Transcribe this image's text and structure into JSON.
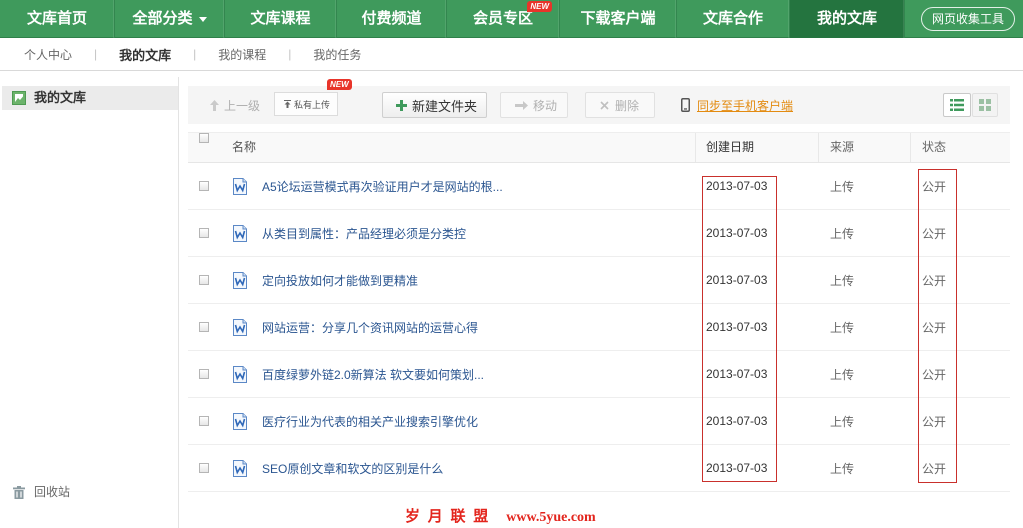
{
  "colors": {
    "nav_green": "#3f9a5c",
    "nav_active": "#24743f",
    "badge_red": "#e8342a",
    "link_orange": "#e38b11",
    "title_blue": "#2a5590",
    "annotation_red": "#c9302c",
    "watermark_red": "#e3251d"
  },
  "nav": {
    "items": [
      {
        "label": "文库首页"
      },
      {
        "label": "全部分类",
        "icon": "caret-down-icon"
      },
      {
        "label": "文库课程"
      },
      {
        "label": "付费频道"
      },
      {
        "label": "会员专区",
        "badge": "NEW"
      },
      {
        "label": "下载客户端"
      },
      {
        "label": "文库合作"
      },
      {
        "label": "我的文库",
        "active": true
      }
    ],
    "tool_button": "网页收集工具"
  },
  "subnav": {
    "separator": "|",
    "items": [
      {
        "label": "个人中心"
      },
      {
        "label": "我的文库",
        "active": true
      },
      {
        "label": "我的课程"
      },
      {
        "label": "我的任务"
      }
    ]
  },
  "sidebar": {
    "library": {
      "label": "我的文库",
      "icon": "library-icon",
      "selected": true
    },
    "recycle_bin": {
      "label": "回收站",
      "icon": "trash-icon"
    }
  },
  "toolbar": {
    "up_level": {
      "label": "上一级",
      "icon": "arrow-up-icon",
      "disabled": true
    },
    "private_upload": {
      "label": "私有上传",
      "icon": "upload-icon",
      "badge": "NEW"
    },
    "new_folder": {
      "label": "新建文件夹",
      "icon": "plus-icon"
    },
    "move": {
      "label": "移动",
      "icon": "arrow-right-icon",
      "disabled": true
    },
    "delete": {
      "label": "删除",
      "icon": "close-icon",
      "disabled": true
    },
    "sync_mobile": {
      "label": "同步至手机客户端",
      "icon": "phone-icon"
    },
    "view_modes": [
      {
        "icon": "list-view-icon",
        "active": true
      },
      {
        "icon": "grid-view-icon",
        "active": false
      }
    ]
  },
  "table": {
    "columns": {
      "name": "名称",
      "date": "创建日期",
      "source": "来源",
      "status": "状态"
    },
    "rows": [
      {
        "title": "A5论坛运营模式再次验证用户才是网站的根...",
        "date": "2013-07-03",
        "source": "上传",
        "status": "公开",
        "icon": "word-doc-icon"
      },
      {
        "title": "从类目到属性：产品经理必须是分类控",
        "date": "2013-07-03",
        "source": "上传",
        "status": "公开",
        "icon": "word-doc-icon"
      },
      {
        "title": "定向投放如何才能做到更精准",
        "date": "2013-07-03",
        "source": "上传",
        "status": "公开",
        "icon": "word-doc-icon"
      },
      {
        "title": "网站运营：分享几个资讯网站的运营心得",
        "date": "2013-07-03",
        "source": "上传",
        "status": "公开",
        "icon": "word-doc-icon"
      },
      {
        "title": "百度绿萝外链2.0新算法 软文要如何策划...",
        "date": "2013-07-03",
        "source": "上传",
        "status": "公开",
        "icon": "word-doc-icon"
      },
      {
        "title": "医疗行业为代表的相关产业搜索引擎优化",
        "date": "2013-07-03",
        "source": "上传",
        "status": "公开",
        "icon": "word-doc-icon"
      },
      {
        "title": "SEO原创文章和软文的区别是什么",
        "date": "2013-07-03",
        "source": "上传",
        "status": "公开",
        "icon": "word-doc-icon"
      }
    ]
  },
  "watermark": {
    "text": "岁 月 联 盟",
    "url": "www.5yue.com"
  }
}
